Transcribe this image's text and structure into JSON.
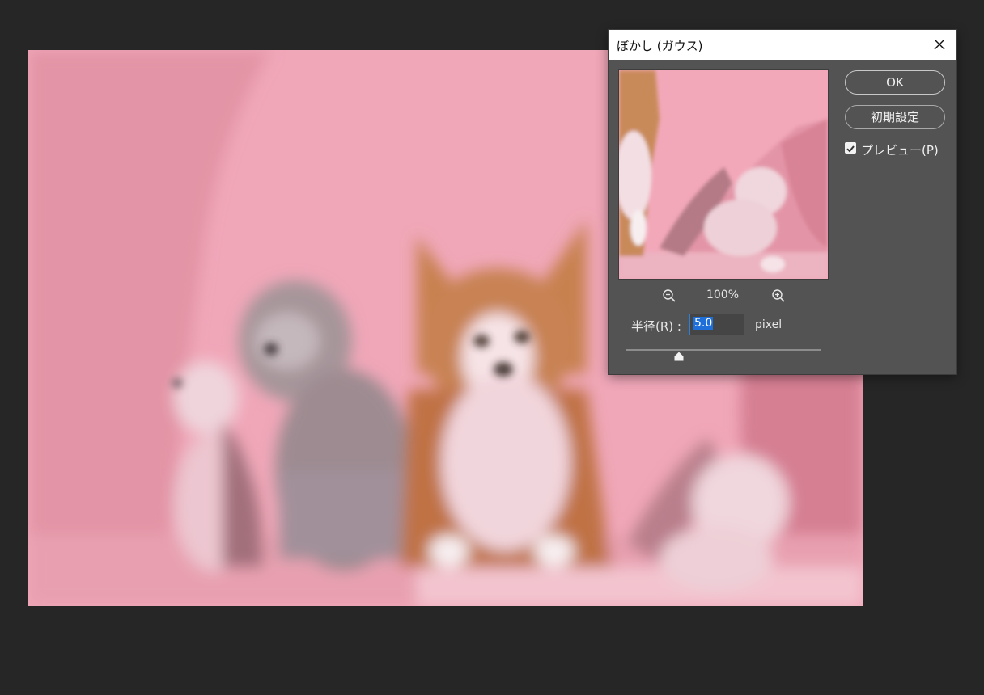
{
  "dialog": {
    "title": "ぼかし (ガウス)",
    "ok_label": "OK",
    "reset_label": "初期設定",
    "preview_label": "プレビュー(P)",
    "preview_checked": true
  },
  "zoom": {
    "value": "100%"
  },
  "radius": {
    "label": "半径(R) :",
    "value": "5.0",
    "unit": "pixel",
    "slider_fraction": 0.27
  },
  "icons": {
    "close": "close-icon",
    "zoom_out": "zoom-out-icon",
    "zoom_in": "zoom-in-icon",
    "checkbox": "checkmark-icon",
    "slider": "slider-thumb-icon"
  },
  "colors": {
    "canvas_bg": "#262626",
    "dialog_bg": "#535353",
    "selection": "#1e6fd9",
    "photo_pink": "#f0a6b7"
  }
}
